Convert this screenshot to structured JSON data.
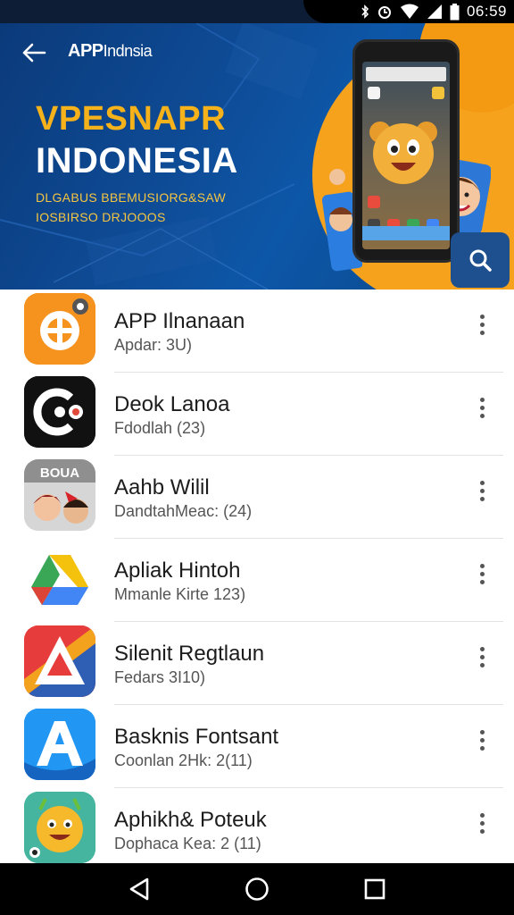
{
  "status_bar": {
    "time": "06:59"
  },
  "header": {
    "brand_bold": "APP",
    "brand_rest": "Indnsia"
  },
  "hero": {
    "title_line1": "VPESNAPR",
    "title_line2": "INDONESIA",
    "subtitle_line1": "DLGABUS BBEMUSIORG&SAW",
    "subtitle_line2": "IOSBIRSO DRJOOOS"
  },
  "apps": [
    {
      "name": "APP Ilnanaan",
      "meta": "Apdar: 3U)",
      "icon": "orange-plus-icon",
      "color": "#f6921e"
    },
    {
      "name": "Deok Lanoa",
      "meta": "Fdodlah (23)",
      "icon": "black-c-icon",
      "color": "#111111"
    },
    {
      "name": "Aahb Wilil",
      "meta": "DandtahMeac: (24)",
      "icon": "cartoon-faces-icon",
      "color": "#c9c9c9"
    },
    {
      "name": "Apliak Hintoh",
      "meta": "Mmanle Kirte 123)",
      "icon": "drive-triangle-icon",
      "color": "#ffffff"
    },
    {
      "name": "Silenit Regtlaun",
      "meta": "Fedars 3I10)",
      "icon": "rainbow-a-icon",
      "color": "#e73c3c"
    },
    {
      "name": "Basknis Fontsant",
      "meta": "Coonlan 2Hk: 2(11)",
      "icon": "blue-a-icon",
      "color": "#1e88e5"
    },
    {
      "name": "Aphikh& Poteuk",
      "meta": "Dophaca Kea: 2 (11)",
      "icon": "smiley-ball-icon",
      "color": "#3cb09b"
    }
  ]
}
